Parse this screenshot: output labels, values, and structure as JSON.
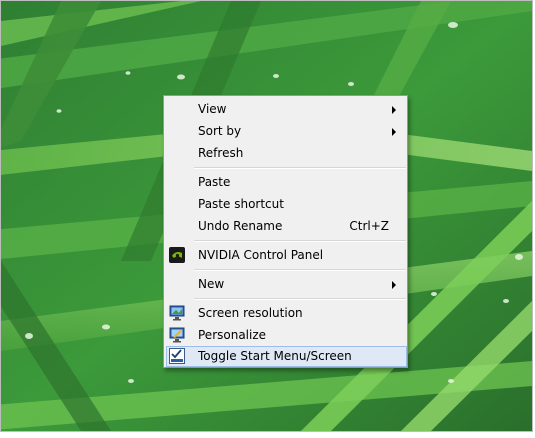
{
  "context_menu": {
    "items": [
      {
        "label": "View",
        "submenu": true
      },
      {
        "label": "Sort by",
        "submenu": true
      },
      {
        "label": "Refresh"
      },
      {
        "label": "Paste"
      },
      {
        "label": "Paste shortcut"
      },
      {
        "label": "Undo Rename",
        "shortcut": "Ctrl+Z"
      },
      {
        "label": "NVIDIA Control Panel",
        "icon": "nvidia-icon"
      },
      {
        "label": "New",
        "submenu": true
      },
      {
        "label": "Screen resolution",
        "icon": "screen-resolution-icon"
      },
      {
        "label": "Personalize",
        "icon": "personalize-icon"
      },
      {
        "label": "Toggle Start Menu/Screen",
        "icon": "checkbox-icon",
        "highlighted": true
      }
    ]
  },
  "colors": {
    "menu_background": "#f0f0f0",
    "menu_border": "#979797",
    "highlight_background": "#dfe9f6",
    "highlight_border": "#9cbde6",
    "wallpaper_green": "#3c9a3a"
  }
}
